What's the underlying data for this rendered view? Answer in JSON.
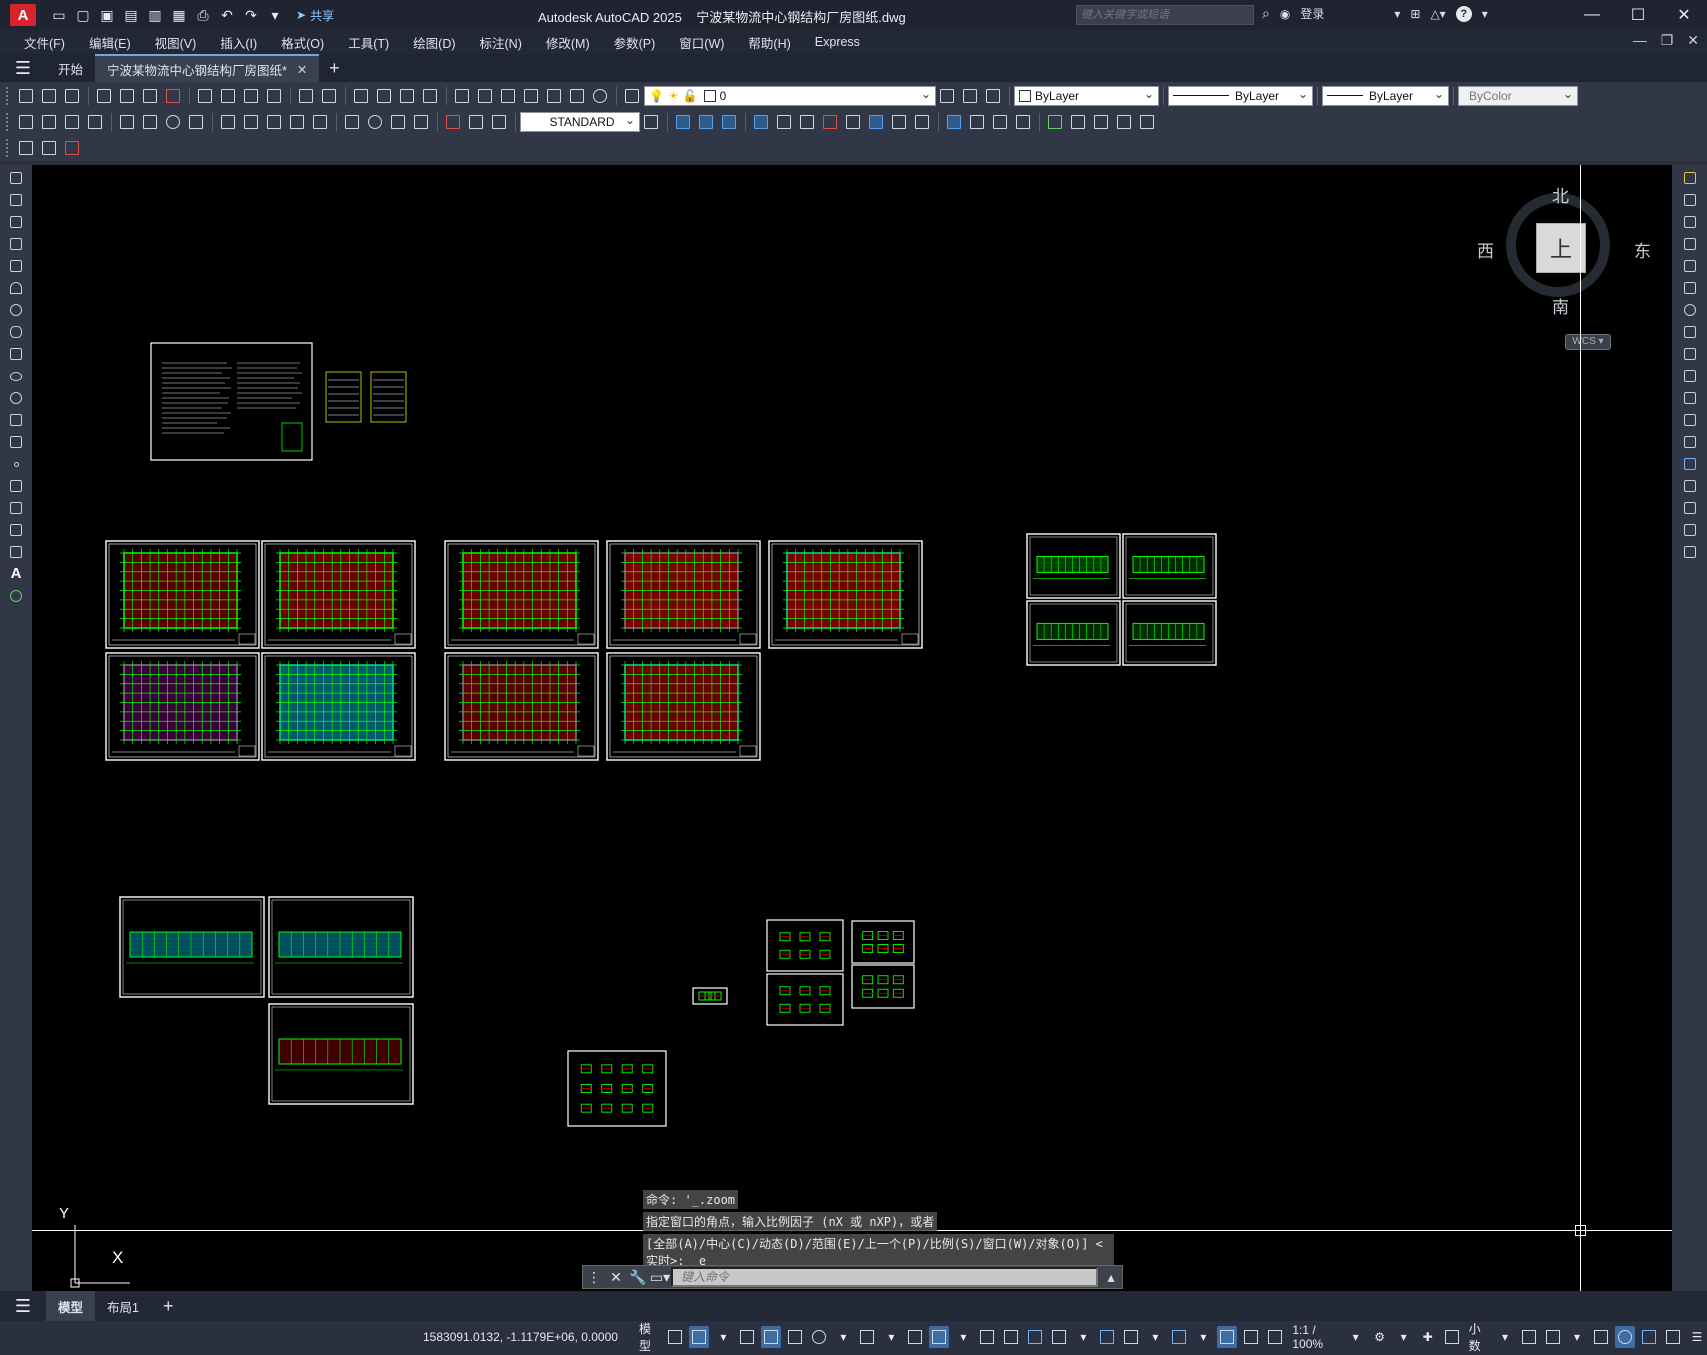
{
  "app": {
    "logo_letter": "A",
    "title": "Autodesk AutoCAD 2025",
    "filename": "宁波某物流中心钢结构厂房图纸.dwg",
    "share_label": "共享",
    "search_placeholder": "键入关键字或短语",
    "login_label": "登录",
    "help_label": "?"
  },
  "menu": [
    "文件(F)",
    "编辑(E)",
    "视图(V)",
    "插入(I)",
    "格式(O)",
    "工具(T)",
    "绘图(D)",
    "标注(N)",
    "修改(M)",
    "参数(P)",
    "窗口(W)",
    "帮助(H)",
    "Express"
  ],
  "tabs": {
    "start": "开始",
    "active_doc": "宁波某物流中心钢结构厂房图纸*",
    "close": "✕",
    "add": "+"
  },
  "toolbars": {
    "layer_value": "0",
    "color_value": "ByLayer",
    "linetype_value": "ByLayer",
    "lineweight_value": "ByLayer",
    "plotstyle_value": "ByColor",
    "text_style_value": "STANDARD"
  },
  "viewcube": {
    "north": "北",
    "south": "南",
    "east": "东",
    "west": "西",
    "face": "上",
    "wcs": "WCS"
  },
  "ucs": {
    "x": "X",
    "y": "Y"
  },
  "command": {
    "history_1": "命令: '_.zoom",
    "history_2": "指定窗口的角点，输入比例因子 (nX 或 nXP)，或者",
    "history_3": "[全部(A)/中心(C)/动态(D)/范围(E)/上一个(P)/比例(S)/窗口(W)/对象(O)] <",
    "history_4": "实时>: _e",
    "input_placeholder": "键入命令"
  },
  "layout_tabs": {
    "model": "模型",
    "layout1": "布局1",
    "add": "+"
  },
  "status": {
    "coordinates": "1583091.0132, -1.1179E+06, 0.0000",
    "model_label": "模型",
    "scale": "1:1 / 100%",
    "units": "小数"
  },
  "colors": {
    "accent": "#3e6da3",
    "canvas": "#000000",
    "drawing_green": "#00ff00",
    "drawing_red": "#c00000",
    "drawing_magenta": "#ff00ff",
    "drawing_cyan": "#00c8ff"
  }
}
